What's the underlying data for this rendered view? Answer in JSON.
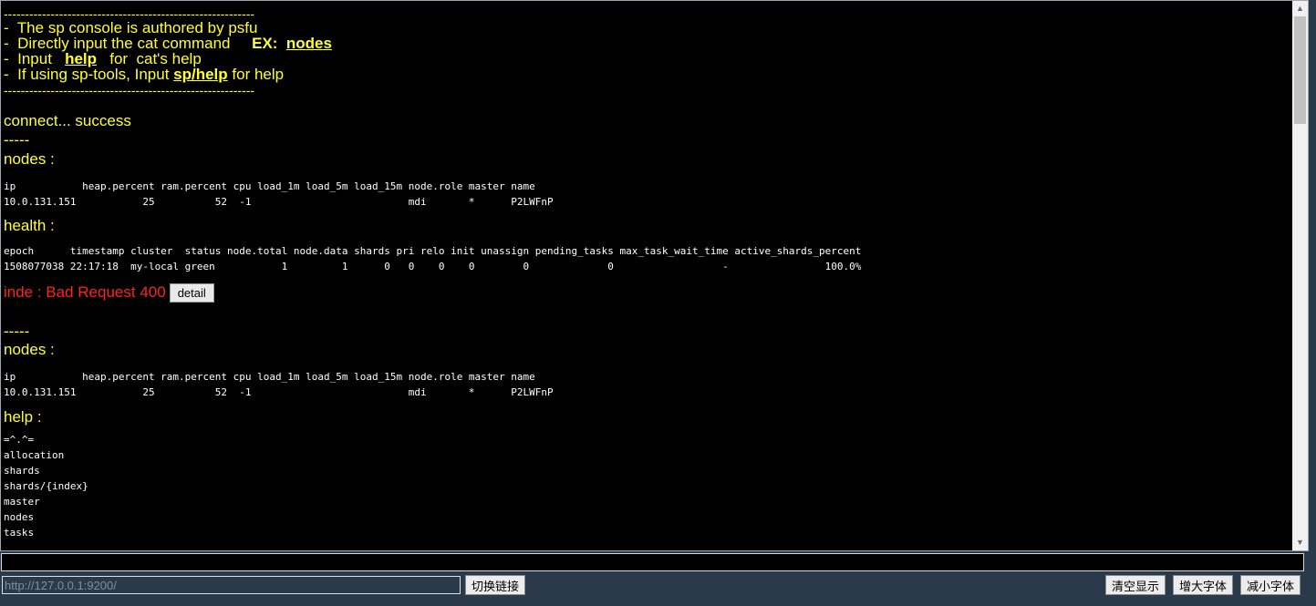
{
  "console": {
    "separator": "-----------------------------------------------------------",
    "intro": {
      "line1": "-  The sp console is authored by psfu",
      "line2_text": "-  Directly input the cat command     ",
      "line2_ex": "EX:  ",
      "line2_link": "nodes",
      "line3_text": "-  Input   ",
      "line3_link": "help",
      "line3_rest": "   for  cat's help",
      "line4_text": "-  If using sp-tools, Input ",
      "line4_link": "sp/help",
      "line4_rest": " for help"
    },
    "connect": "connect... success",
    "dash": "-----",
    "nodes_title": "nodes :",
    "nodes_header": "ip           heap.percent ram.percent cpu load_1m load_5m load_15m node.role master name",
    "nodes_row": "10.0.131.151           25          52  -1                          mdi       *      P2LWFnP",
    "health_title": "health :",
    "health_header": "epoch      timestamp cluster  status node.total node.data shards pri relo init unassign pending_tasks max_task_wait_time active_shards_percent",
    "health_row": "1508077038 22:17:18  my-local green           1         1      0   0    0    0        0             0                  -                100.0%",
    "error_text": "inde : Bad Request 400",
    "detail_label": "detail",
    "help_title": "help :",
    "help_items": [
      "=^.^=",
      "allocation",
      "shards",
      "shards/{index}",
      "master",
      "nodes",
      "tasks"
    ]
  },
  "controls": {
    "url_placeholder": "http://127.0.0.1:9200/",
    "switch_label": "切换链接",
    "clear_label": "清空显示",
    "increase_label": "增大字体",
    "decrease_label": "减小字体"
  }
}
